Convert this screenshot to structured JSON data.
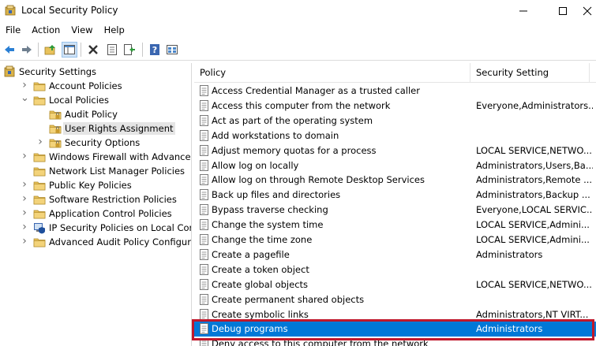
{
  "window": {
    "title": "Local Security Policy"
  },
  "menu": [
    "File",
    "Action",
    "View",
    "Help"
  ],
  "toolbar": {
    "buttons": [
      "back-icon",
      "forward-icon",
      "up-folder-icon",
      "show-hide-tree-icon",
      "delete-icon",
      "properties-icon",
      "export-list-icon",
      "help-icon",
      "view-icon"
    ]
  },
  "tree": {
    "items": [
      {
        "label": "Security Settings",
        "level": 0,
        "expander": "none",
        "icon": "security-settings-icon"
      },
      {
        "label": "Account Policies",
        "level": 1,
        "expander": "collapsed",
        "icon": "folder-icon"
      },
      {
        "label": "Local Policies",
        "level": 1,
        "expander": "expanded",
        "icon": "folder-icon"
      },
      {
        "label": "Audit Policy",
        "level": 2,
        "expander": "none",
        "icon": "folder-icon"
      },
      {
        "label": "User Rights Assignment",
        "level": 2,
        "expander": "none",
        "icon": "folder-icon",
        "selected": true
      },
      {
        "label": "Security Options",
        "level": 2,
        "expander": "collapsed",
        "icon": "folder-icon"
      },
      {
        "label": "Windows Firewall with Advanced Secu",
        "level": 1,
        "expander": "collapsed",
        "icon": "folder-icon"
      },
      {
        "label": "Network List Manager Policies",
        "level": 1,
        "expander": "none",
        "icon": "folder-icon"
      },
      {
        "label": "Public Key Policies",
        "level": 1,
        "expander": "collapsed",
        "icon": "folder-icon"
      },
      {
        "label": "Software Restriction Policies",
        "level": 1,
        "expander": "collapsed",
        "icon": "folder-icon"
      },
      {
        "label": "Application Control Policies",
        "level": 1,
        "expander": "collapsed",
        "icon": "folder-icon"
      },
      {
        "label": "IP Security Policies on Local Compute",
        "level": 1,
        "expander": "collapsed",
        "icon": "ip-security-icon"
      },
      {
        "label": "Advanced Audit Policy Configuration",
        "level": 1,
        "expander": "collapsed",
        "icon": "folder-icon"
      }
    ]
  },
  "list": {
    "columns": {
      "policy": "Policy",
      "setting": "Security Setting"
    },
    "rows": [
      {
        "policy": "Access Credential Manager as a trusted caller",
        "setting": ""
      },
      {
        "policy": "Access this computer from the network",
        "setting": "Everyone,Administrators..."
      },
      {
        "policy": "Act as part of the operating system",
        "setting": ""
      },
      {
        "policy": "Add workstations to domain",
        "setting": ""
      },
      {
        "policy": "Adjust memory quotas for a process",
        "setting": "LOCAL SERVICE,NETWO..."
      },
      {
        "policy": "Allow log on locally",
        "setting": "Administrators,Users,Ba..."
      },
      {
        "policy": "Allow log on through Remote Desktop Services",
        "setting": "Administrators,Remote ..."
      },
      {
        "policy": "Back up files and directories",
        "setting": "Administrators,Backup ..."
      },
      {
        "policy": "Bypass traverse checking",
        "setting": "Everyone,LOCAL SERVIC..."
      },
      {
        "policy": "Change the system time",
        "setting": "LOCAL SERVICE,Admini..."
      },
      {
        "policy": "Change the time zone",
        "setting": "LOCAL SERVICE,Admini..."
      },
      {
        "policy": "Create a pagefile",
        "setting": "Administrators"
      },
      {
        "policy": "Create a token object",
        "setting": ""
      },
      {
        "policy": "Create global objects",
        "setting": "LOCAL SERVICE,NETWO..."
      },
      {
        "policy": "Create permanent shared objects",
        "setting": ""
      },
      {
        "policy": "Create symbolic links",
        "setting": "Administrators,NT VIRT..."
      },
      {
        "policy": "Debug programs",
        "setting": "Administrators",
        "selected": true
      },
      {
        "policy": "Deny access to this computer from the network",
        "setting": ""
      }
    ]
  },
  "colors": {
    "selection": "#0078d7",
    "highlight_box": "#c0182b",
    "folder": "#e8c25b"
  }
}
